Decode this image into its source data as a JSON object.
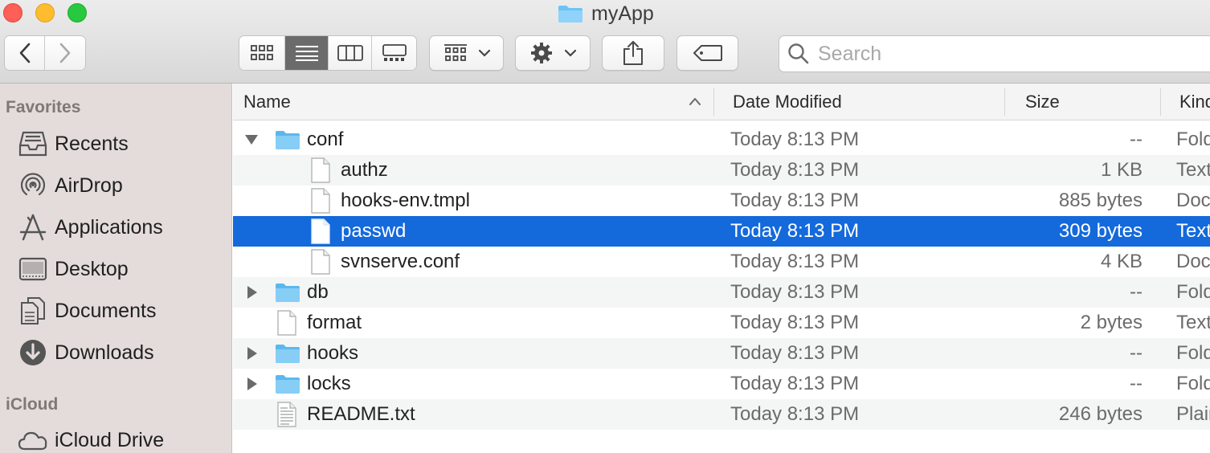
{
  "window": {
    "title": "myApp"
  },
  "toolbar": {
    "back": "back",
    "forward": "forward",
    "views": [
      "icon-view",
      "list-view",
      "column-view",
      "gallery-view"
    ],
    "active_view": "list-view",
    "group": "group",
    "action": "action",
    "share": "share",
    "tags": "tags"
  },
  "search": {
    "placeholder": "Search",
    "value": ""
  },
  "sidebar": {
    "favorites_heading": "Favorites",
    "favorites": [
      {
        "label": "Recents",
        "icon": "recents-icon"
      },
      {
        "label": "AirDrop",
        "icon": "airdrop-icon"
      },
      {
        "label": "Applications",
        "icon": "applications-icon"
      },
      {
        "label": "Desktop",
        "icon": "desktop-icon"
      },
      {
        "label": "Documents",
        "icon": "documents-icon"
      },
      {
        "label": "Downloads",
        "icon": "downloads-icon"
      }
    ],
    "icloud_heading": "iCloud",
    "icloud": [
      {
        "label": "iCloud Drive",
        "icon": "icloud-icon"
      }
    ]
  },
  "columns": {
    "name": "Name",
    "date": "Date Modified",
    "size": "Size",
    "kind": "Kind"
  },
  "rows": [
    {
      "name": "conf",
      "type": "folder",
      "expanded": true,
      "date": "Today 8:13 PM",
      "size": "--",
      "kind": "Folder"
    },
    {
      "name": "authz",
      "type": "file",
      "date": "Today 8:13 PM",
      "size": "1 KB",
      "kind": "Text"
    },
    {
      "name": "hooks-env.tmpl",
      "type": "file",
      "date": "Today 8:13 PM",
      "size": "885 bytes",
      "kind": "Document"
    },
    {
      "name": "passwd",
      "type": "file",
      "date": "Today 8:13 PM",
      "size": "309 bytes",
      "kind": "Text",
      "selected": true
    },
    {
      "name": "svnserve.conf",
      "type": "file",
      "date": "Today 8:13 PM",
      "size": "4 KB",
      "kind": "Document"
    },
    {
      "name": "db",
      "type": "folder",
      "expanded": false,
      "date": "Today 8:13 PM",
      "size": "--",
      "kind": "Folder"
    },
    {
      "name": "format",
      "type": "file",
      "date": "Today 8:13 PM",
      "size": "2 bytes",
      "kind": "Text"
    },
    {
      "name": "hooks",
      "type": "folder",
      "expanded": false,
      "date": "Today 8:13 PM",
      "size": "--",
      "kind": "Folder"
    },
    {
      "name": "locks",
      "type": "folder",
      "expanded": false,
      "date": "Today 8:13 PM",
      "size": "--",
      "kind": "Folder"
    },
    {
      "name": "README.txt",
      "type": "textfile",
      "date": "Today 8:13 PM",
      "size": "246 bytes",
      "kind": "Plain Text"
    }
  ],
  "colors": {
    "selection": "#1469db",
    "folder": "#6cc3f5",
    "sidebar": "#e3dcda"
  }
}
